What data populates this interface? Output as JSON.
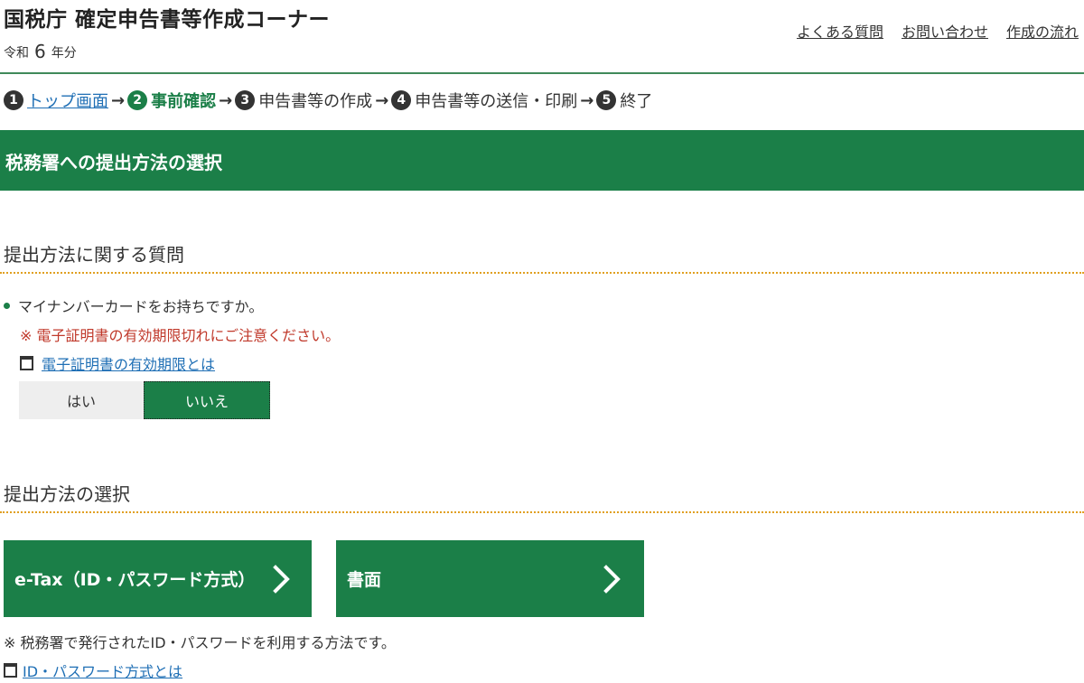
{
  "header": {
    "title": "国税庁 確定申告書等作成コーナー",
    "era": "令和",
    "year": "6",
    "year_suffix": "年分",
    "links": [
      "よくある質問",
      "お問い合わせ",
      "作成の流れ"
    ]
  },
  "steps": [
    {
      "num": "1",
      "label": "トップ画面"
    },
    {
      "num": "2",
      "label": "事前確認"
    },
    {
      "num": "3",
      "label": "申告書等の作成"
    },
    {
      "num": "4",
      "label": "申告書等の送信・印刷"
    },
    {
      "num": "5",
      "label": "終了"
    }
  ],
  "banner": {
    "title": "税務署への提出方法の選択"
  },
  "question_section": {
    "heading": "提出方法に関する質問",
    "question": "マイナンバーカードをお持ちですか。",
    "warning": "※ 電子証明書の有効期限切れにご注意ください。",
    "help_link": "電子証明書の有効期限とは",
    "options": {
      "yes": "はい",
      "no": "いいえ"
    },
    "selected": "いいえ"
  },
  "method_section": {
    "heading": "提出方法の選択",
    "etax_button": "e-Tax（ID・パスワード方式）",
    "paper_button": "書面",
    "note": "※ 税務署で発行されたID・パスワードを利用する方法です。",
    "help_link": "ID・パスワード方式とは"
  },
  "colors": {
    "brand_green": "#1b7f48",
    "link_blue": "#1f6fb5",
    "warning_red": "#c0392b",
    "dotted_rule": "#e0a020"
  }
}
